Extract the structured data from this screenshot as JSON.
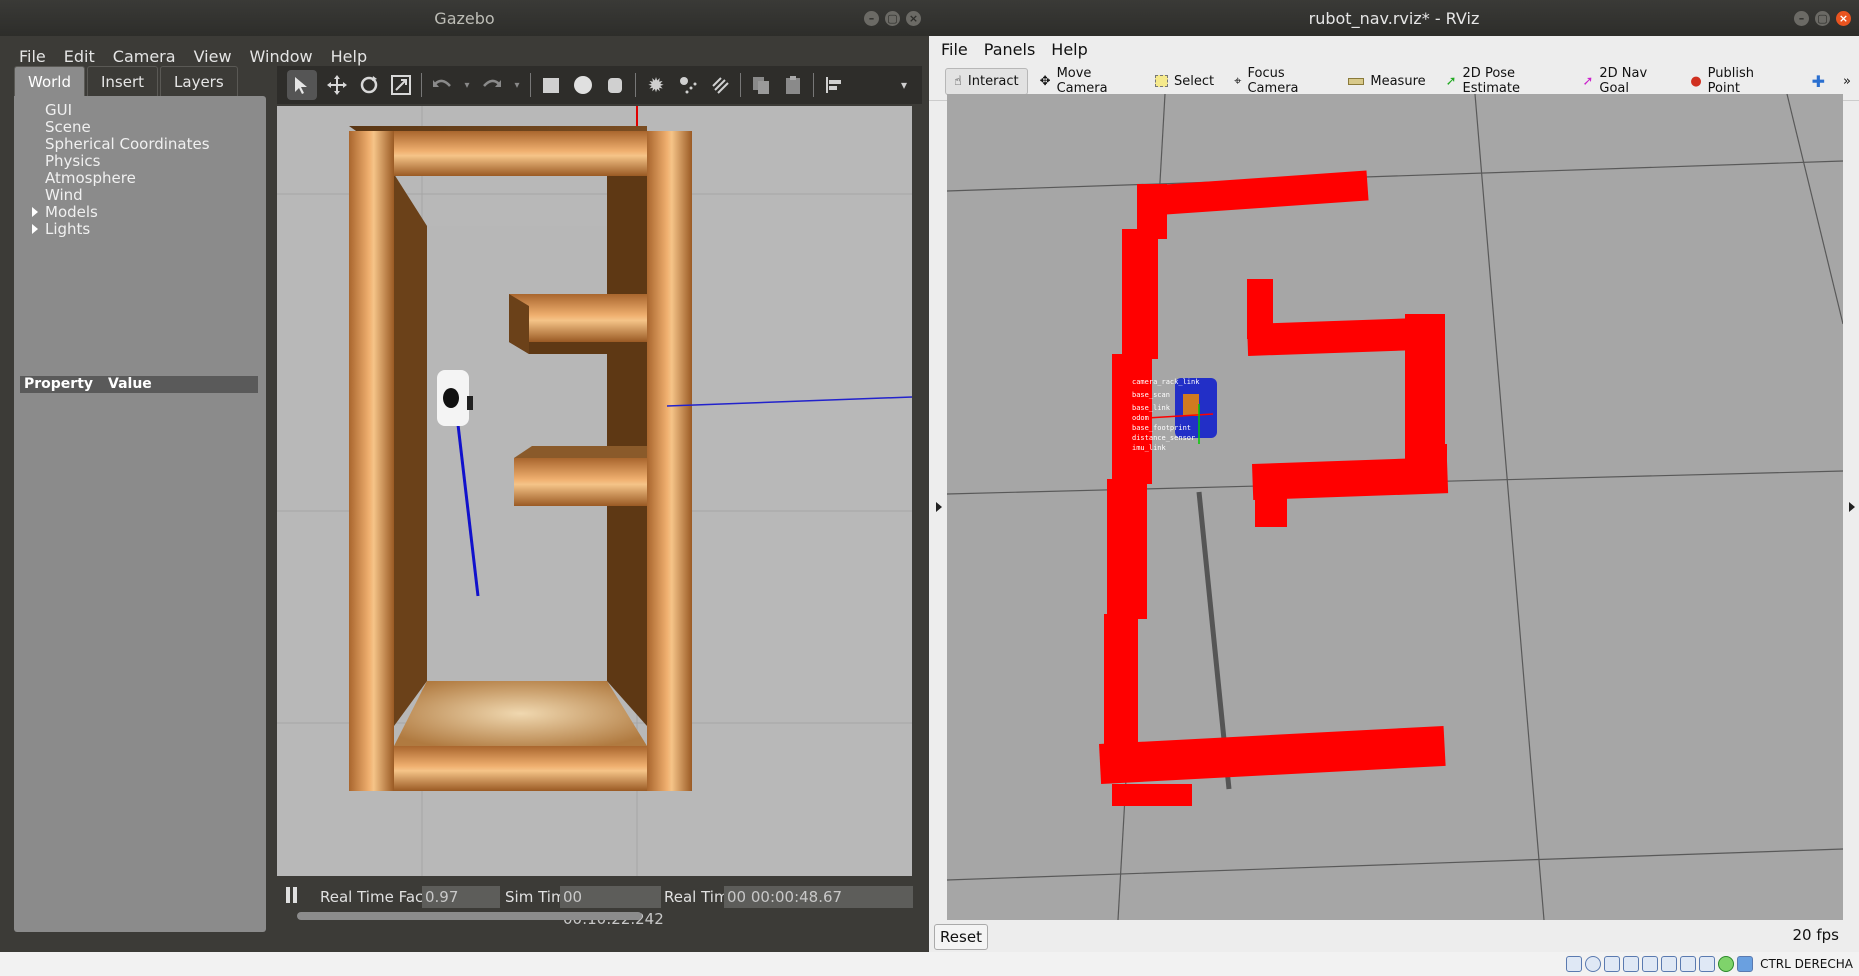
{
  "gazebo": {
    "title": "Gazebo",
    "window_buttons": [
      "–",
      "▢",
      "×"
    ],
    "menu": [
      "File",
      "Edit",
      "Camera",
      "View",
      "Window",
      "Help"
    ],
    "tabs": [
      "World",
      "Insert",
      "Layers"
    ],
    "tree": [
      "GUI",
      "Scene",
      "Spherical Coordinates",
      "Physics",
      "Atmosphere",
      "Wind",
      "Models",
      "Lights"
    ],
    "property_header": {
      "property": "Property",
      "value": "Value"
    },
    "status": {
      "real_time_factor_label": "Real Time Factor:",
      "real_time_factor": "0.97",
      "sim_time_label": "Sim Time:",
      "sim_time": "00 00:10:22.242",
      "real_time_label": "Real Time:",
      "real_time": "00 00:00:48.67"
    }
  },
  "rviz": {
    "title": "rubot_nav.rviz* - RViz",
    "window_buttons": [
      "–",
      "▢",
      "×"
    ],
    "menu": [
      "File",
      "Panels",
      "Help"
    ],
    "tools": [
      "Interact",
      "Move Camera",
      "Select",
      "Focus Camera",
      "Measure",
      "2D Pose Estimate",
      "2D Nav Goal",
      "Publish Point"
    ],
    "tf_labels": [
      "camera_rack_link",
      "base_scan",
      "base_link",
      "odom",
      "base_footprint",
      "distance_sensor",
      "imu_link"
    ],
    "reset_label": "Reset",
    "fps": "20 fps"
  },
  "taskbar": {
    "text": "CTRL DERECHA"
  },
  "colors": {
    "scan": "#ff0000",
    "wood": "#c98a4a",
    "gazebo_bg": "#b8b8b8",
    "rviz_bg": "#a6a6a6"
  }
}
